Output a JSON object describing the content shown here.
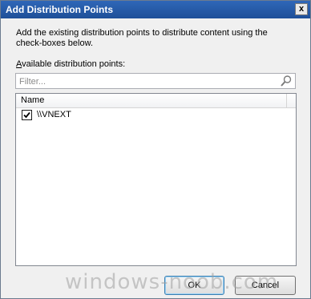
{
  "window": {
    "title": "Add Distribution Points",
    "close_glyph": "x"
  },
  "description": "Add the existing distribution points to distribute content using the check-boxes below.",
  "available_label": {
    "accel": "A",
    "rest": "vailable distribution points:"
  },
  "filter": {
    "placeholder": "Filter...",
    "value": "",
    "icon": "search-icon"
  },
  "list": {
    "column_header": "Name",
    "rows": [
      {
        "label": "\\\\VNEXT",
        "checked": true
      }
    ]
  },
  "buttons": {
    "ok": "OK",
    "cancel": "Cancel"
  },
  "watermark": "windows-noob.com"
}
